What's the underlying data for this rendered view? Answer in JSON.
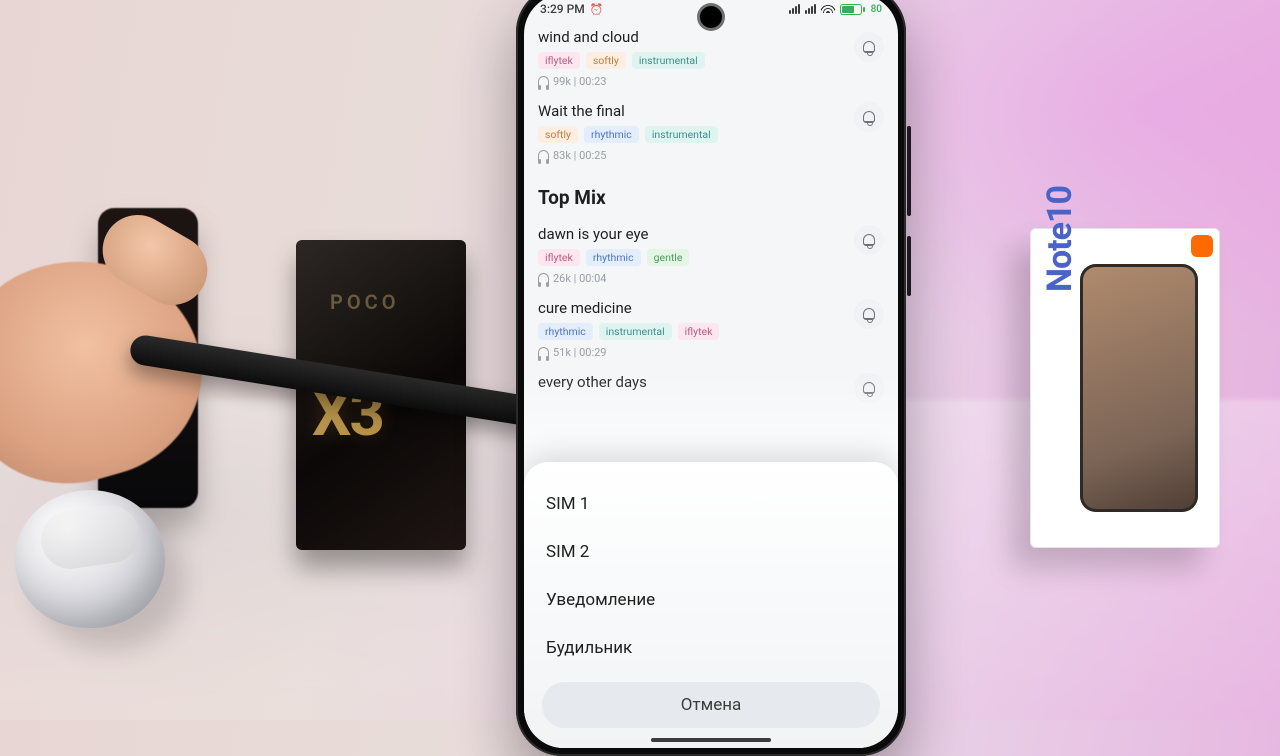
{
  "status": {
    "time": "3:29 PM",
    "battery": "80"
  },
  "tracks_top": [
    {
      "title": "wind and cloud",
      "chips": [
        {
          "t": "iflytek",
          "c": "pink"
        },
        {
          "t": "softly",
          "c": "orange"
        },
        {
          "t": "instrumental",
          "c": "teal"
        }
      ],
      "plays": "99k",
      "dur": "00:23"
    },
    {
      "title": "Wait the final",
      "chips": [
        {
          "t": "softly",
          "c": "orange"
        },
        {
          "t": "rhythmic",
          "c": "blue"
        },
        {
          "t": "instrumental",
          "c": "teal"
        }
      ],
      "plays": "83k",
      "dur": "00:25"
    }
  ],
  "section_title": "Top Mix",
  "tracks_mix": [
    {
      "title": "dawn is your eye",
      "chips": [
        {
          "t": "iflytek",
          "c": "pink"
        },
        {
          "t": "rhythmic",
          "c": "blue"
        },
        {
          "t": "gentle",
          "c": "green"
        }
      ],
      "plays": "26k",
      "dur": "00:04"
    },
    {
      "title": "cure medicine",
      "chips": [
        {
          "t": "rhythmic",
          "c": "blue"
        },
        {
          "t": "instrumental",
          "c": "teal"
        },
        {
          "t": "iflytek",
          "c": "pink"
        }
      ],
      "plays": "51k",
      "dur": "00:29"
    },
    {
      "title": "every other days",
      "chips": [],
      "plays": "",
      "dur": ""
    }
  ],
  "sheet": {
    "options": [
      "SIM 1",
      "SIM 2",
      "Уведомление",
      "Будильник"
    ],
    "cancel": "Отмена"
  },
  "props": {
    "poco_label": "POCO",
    "poco_model": "X3",
    "note10": "Note10"
  }
}
